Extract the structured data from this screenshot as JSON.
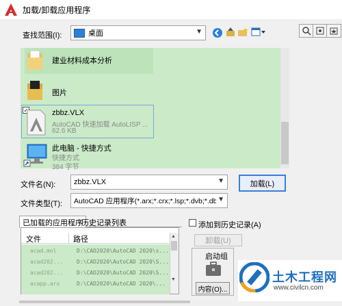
{
  "window": {
    "title": "加载/卸载应用程序"
  },
  "lookin": {
    "label": "查找范围(I):",
    "value": "桌面"
  },
  "files": [
    {
      "name": "建业材料成本分析",
      "sub1": "",
      "sub2": ""
    },
    {
      "name": "图片",
      "sub1": "",
      "sub2": ""
    },
    {
      "name": "zbbz.VLX",
      "sub1": "AutoCAD 快速加载 AutoLISP ...",
      "sub2": "62.6 KB"
    },
    {
      "name": "此电脑 - 快捷方式",
      "sub1": "快捷方式",
      "sub2": "384 字节"
    }
  ],
  "filename": {
    "label": "文件名(N):",
    "value": "zbbz.VLX"
  },
  "filetype": {
    "label": "文件类型(T):",
    "value": "AutoCAD 应用程序(*.arx;*.crx;*.lsp;*.dvb;*.dbx"
  },
  "load_button": "加载(L)",
  "tabs": {
    "loaded": "已加载的应用程序",
    "history": "历史记录列表"
  },
  "history_checkbox": "添加到历史记录(A)",
  "unload_button": "卸载(U)",
  "table": {
    "headers": [
      "文件",
      "路径"
    ],
    "rows": [
      {
        "file": "acad.mnl",
        "path": "D:\\CAD2020\\AutoCAD 2020\\s..."
      },
      {
        "file": "acad202...",
        "path": "D:\\CAD2020\\AutoCAD 2020\\S..."
      },
      {
        "file": "acad202...",
        "path": "D:\\CAD2020\\AutoCAD 2020\\S..."
      },
      {
        "file": "acapp.arx",
        "path": "D:\\CAD2020\\AutoCAD 2020\\..."
      }
    ]
  },
  "startup": {
    "title": "启动组",
    "contents_button": "内容(O)..."
  },
  "watermark": {
    "cn": "土木工程网",
    "url": "www.civilcn.com"
  },
  "colors": {
    "list_bg": "#cbeac8",
    "accent": "#3a7fd8",
    "brand_red": "#d32f2f",
    "watermark_blue": "#1e6fc0"
  }
}
